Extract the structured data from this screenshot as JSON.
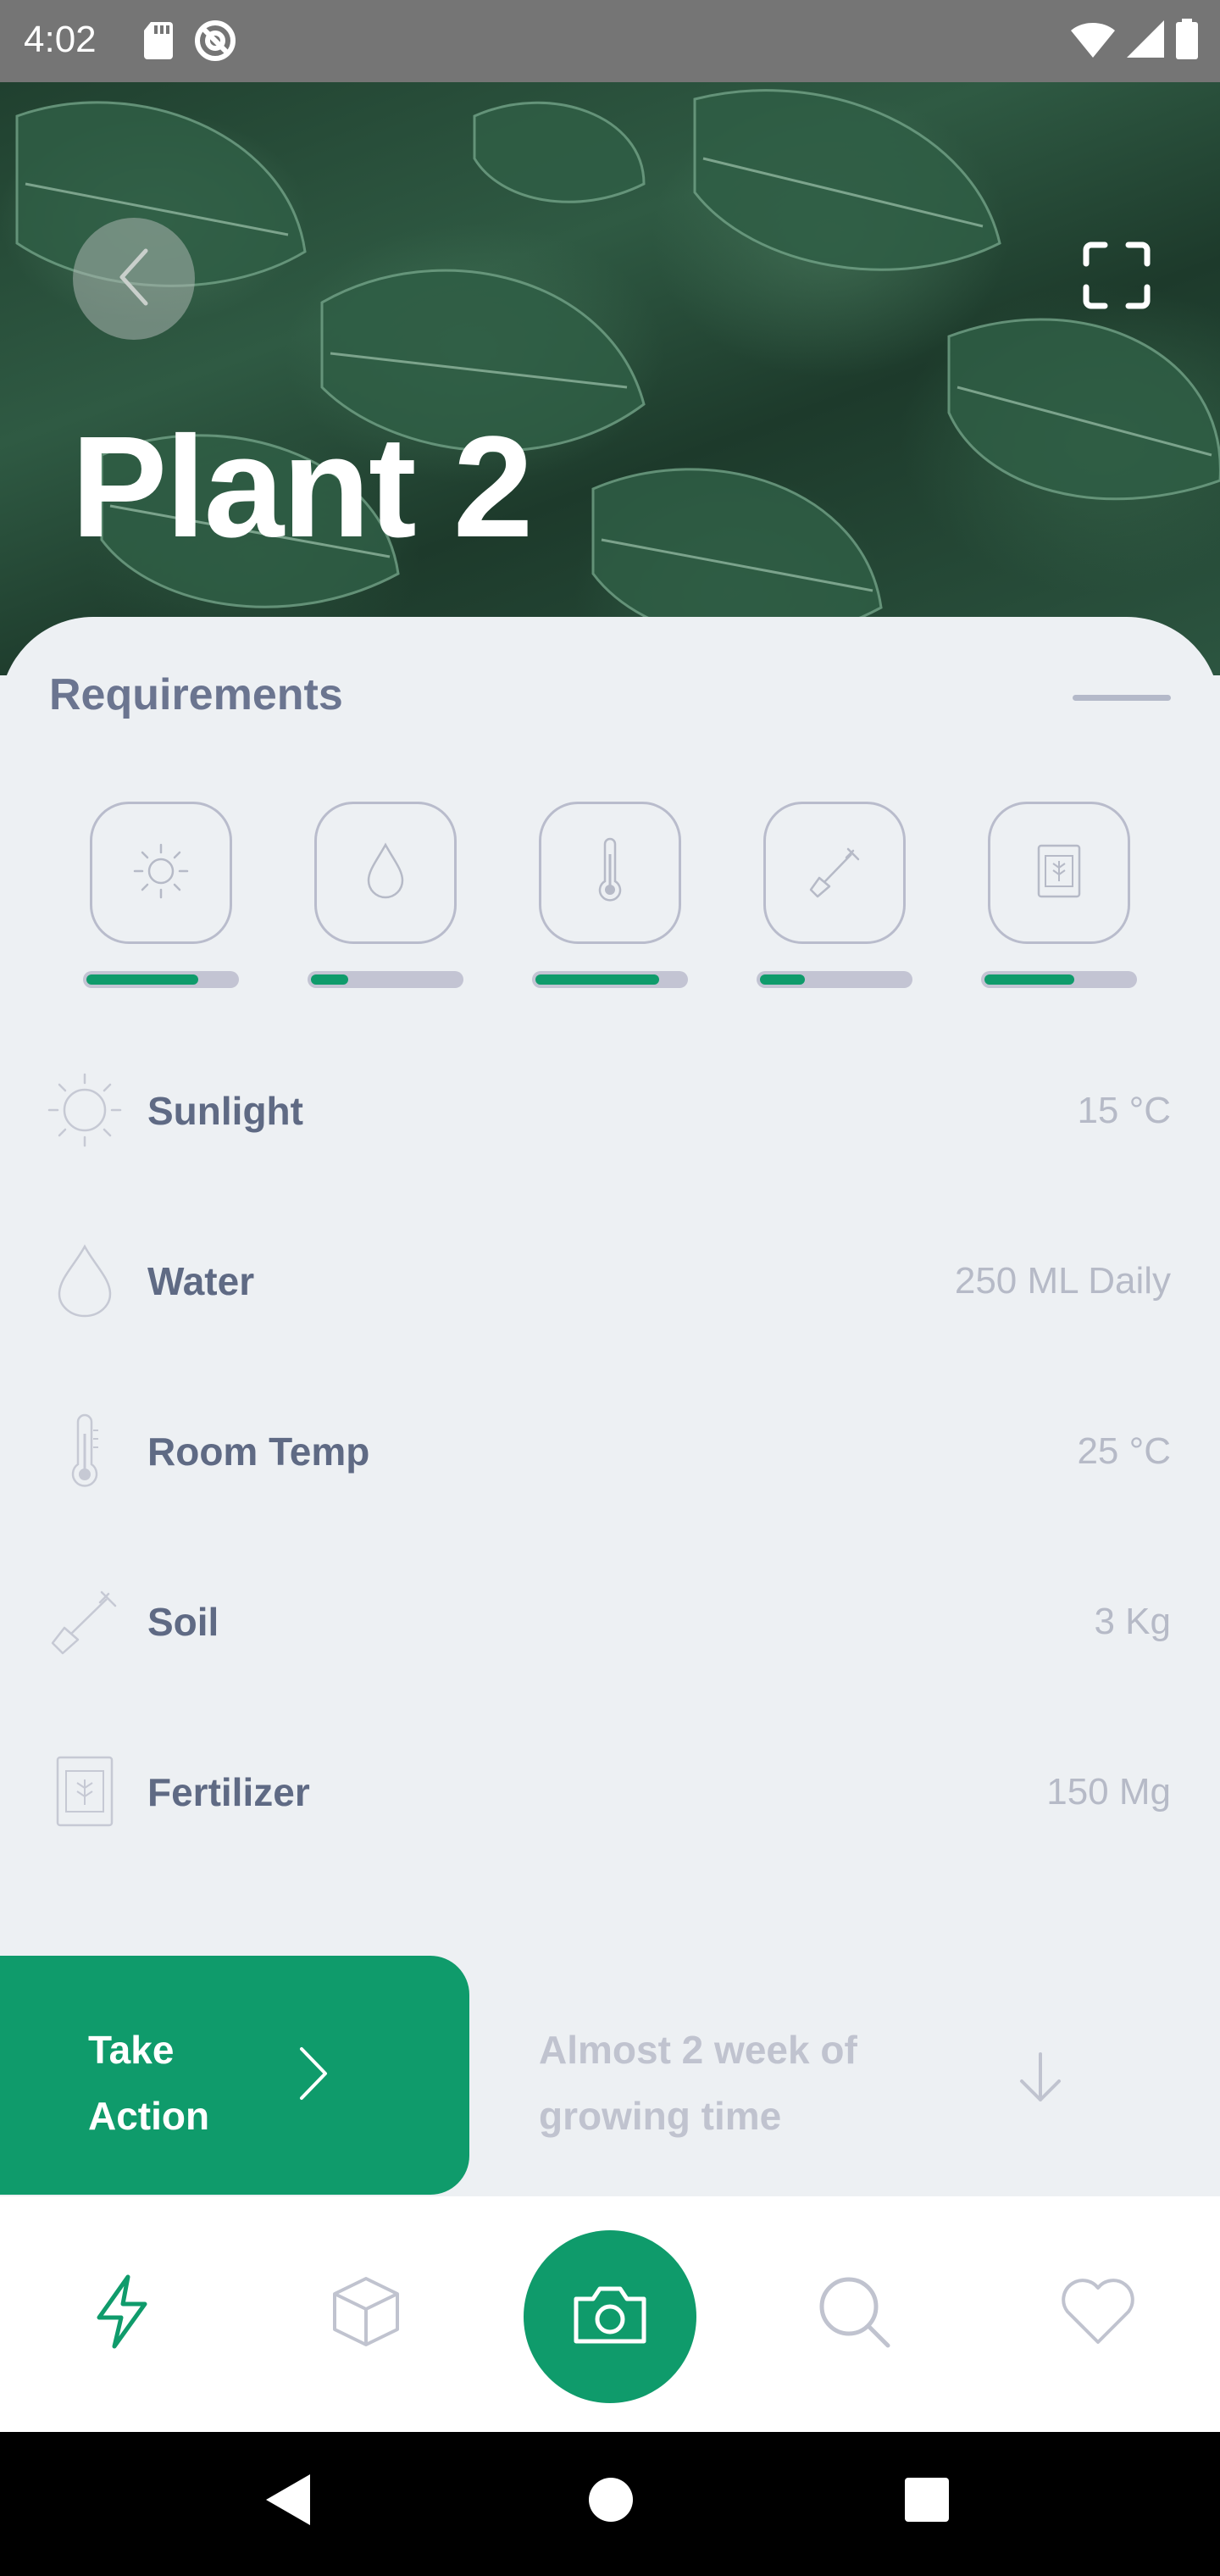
{
  "status_bar": {
    "time": "4:02",
    "icons": [
      "sd-card-icon",
      "sync-icon",
      "wifi-icon",
      "signal-icon",
      "battery-icon"
    ]
  },
  "hero": {
    "title": "Plant 2",
    "back_icon": "chevron-left-icon",
    "fullscreen_icon": "fullscreen-icon"
  },
  "requirements": {
    "title": "Requirements",
    "tiles": [
      {
        "icon": "sun-icon",
        "level": 0.75
      },
      {
        "icon": "water-drop-icon",
        "level": 0.25
      },
      {
        "icon": "thermometer-icon",
        "level": 0.83
      },
      {
        "icon": "shovel-icon",
        "level": 0.3
      },
      {
        "icon": "fertilizer-bag-icon",
        "level": 0.6
      }
    ],
    "items": [
      {
        "icon": "sun-icon",
        "label": "Sunlight",
        "value": "15 °C"
      },
      {
        "icon": "water-drop-icon",
        "label": "Water",
        "value": "250 ML Daily"
      },
      {
        "icon": "thermometer-icon",
        "label": "Room Temp",
        "value": "25 °C"
      },
      {
        "icon": "shovel-icon",
        "label": "Soil",
        "value": "3 Kg"
      },
      {
        "icon": "fertilizer-bag-icon",
        "label": "Fertilizer",
        "value": "150 Mg"
      }
    ]
  },
  "action": {
    "take_action_line1": "Take",
    "take_action_line2": "Action",
    "growing_line1": "Almost 2 week of",
    "growing_line2": "growing time"
  },
  "bottom_nav": {
    "items": [
      "lightning-icon",
      "cube-icon",
      "camera-icon",
      "search-icon",
      "heart-icon"
    ],
    "active": "lightning-icon"
  },
  "colors": {
    "accent": "#0f9b6b",
    "sheet_bg": "#edf0f3",
    "label": "#5f6a84",
    "muted": "#b6bac7"
  }
}
